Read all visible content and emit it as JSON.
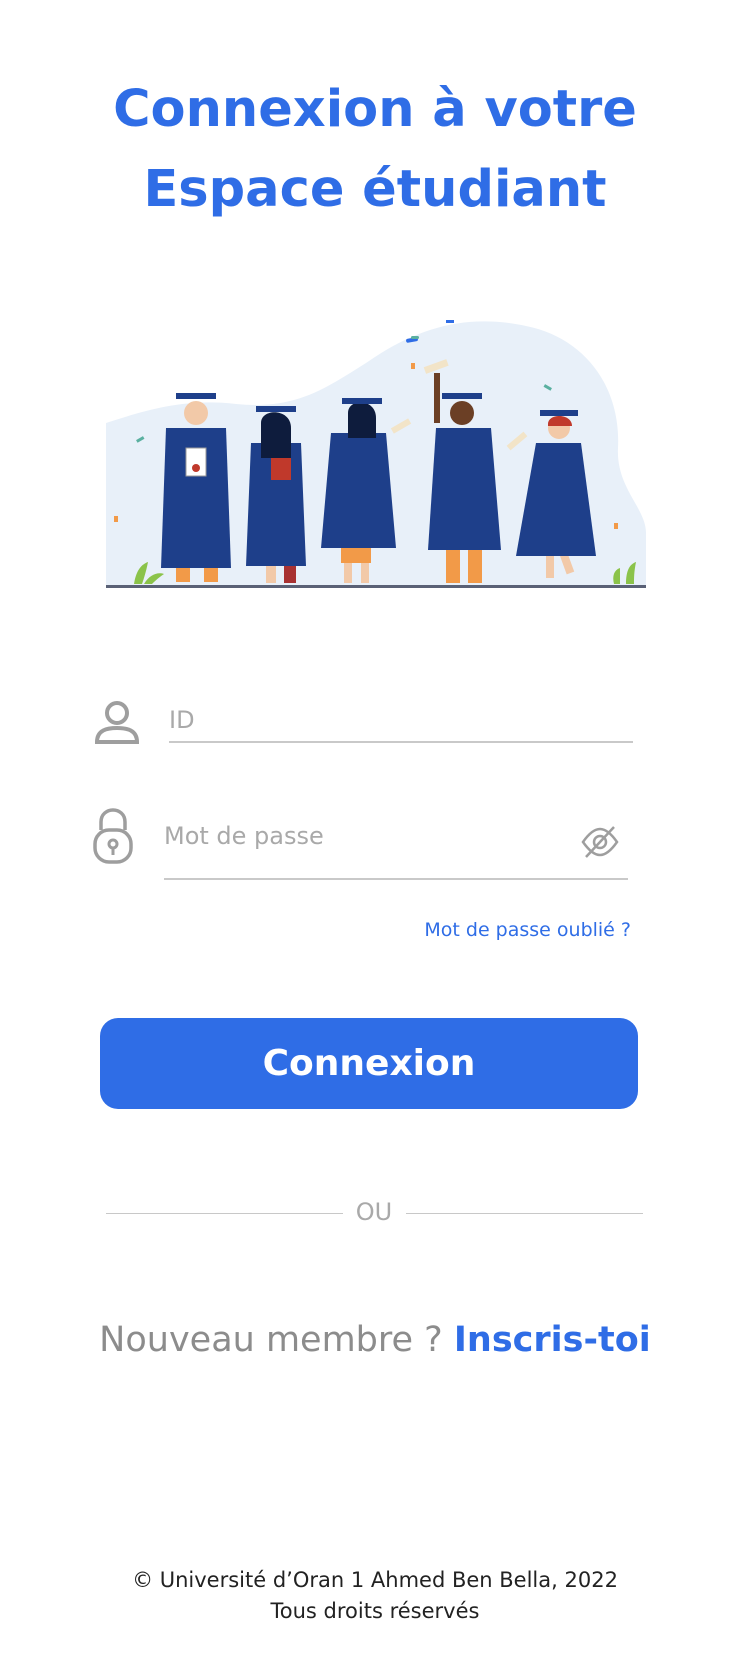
{
  "title": {
    "line1": "Connexion à votre",
    "line2": "Espace étudiant"
  },
  "form": {
    "id_placeholder": "ID",
    "password_placeholder": "Mot de passe",
    "forgot_password": "Mot de passe oublié ?",
    "login_button": "Connexion"
  },
  "divider": {
    "label": "OU"
  },
  "signup": {
    "question": "Nouveau membre ?",
    "link": "Inscris-toi"
  },
  "footer": {
    "copyright": "© Université d’Oran 1 Ahmed Ben Bella, 2022",
    "rights": "Tous droits réservés"
  },
  "icons": {
    "user": "user-icon",
    "lock": "lock-icon",
    "eye": "eye-off-icon"
  },
  "colors": {
    "primary": "#2f6de6",
    "muted": "#a9a9a9"
  }
}
